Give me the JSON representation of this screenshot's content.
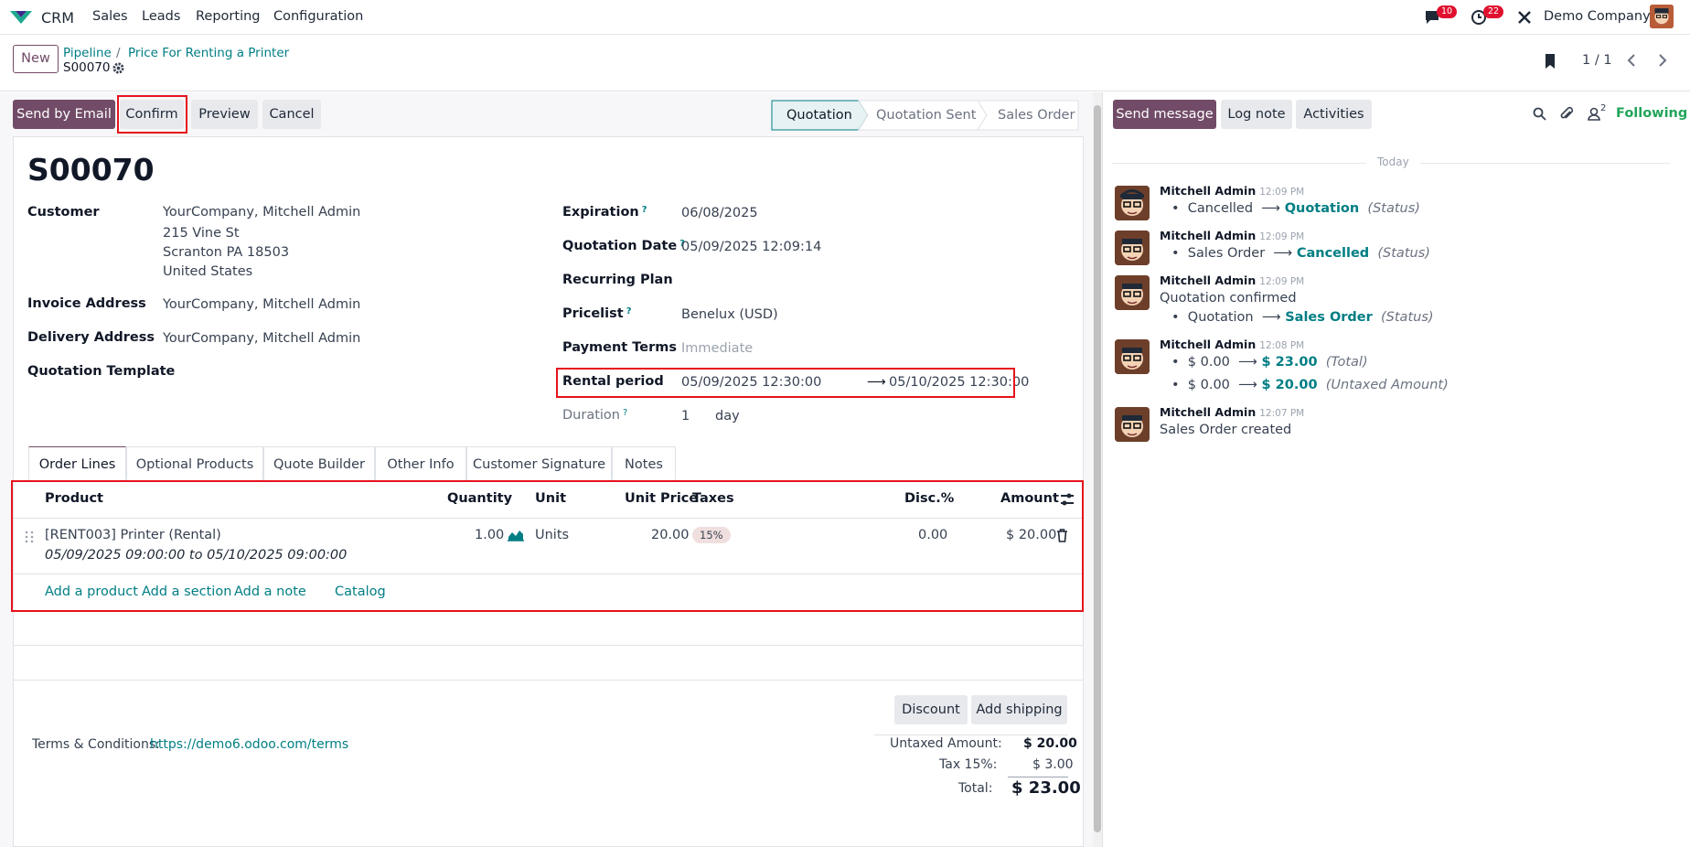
{
  "navbar": {
    "app_name": "CRM",
    "menus": [
      "Sales",
      "Leads",
      "Reporting",
      "Configuration"
    ],
    "messages_count": "10",
    "activities_count": "22",
    "company": "Demo Company"
  },
  "control_panel": {
    "new_label": "New",
    "breadcrumb_1": "Pipeline",
    "breadcrumb_2": "Price For Renting a Printer",
    "record_name": "S00070",
    "pager": "1 / 1"
  },
  "status_bar": {
    "buttons": [
      "Send by Email",
      "Confirm",
      "Preview",
      "Cancel"
    ],
    "stages": [
      "Quotation",
      "Quotation Sent",
      "Sales Order"
    ],
    "active_stage": "Quotation"
  },
  "form": {
    "title": "S00070",
    "customer_label": "Customer",
    "customer_lines": [
      "YourCompany, Mitchell Admin",
      "215 Vine St",
      "Scranton PA 18503",
      "United States"
    ],
    "invoice_label": "Invoice Address",
    "invoice_value": "YourCompany, Mitchell Admin",
    "delivery_label": "Delivery Address",
    "delivery_value": "YourCompany, Mitchell Admin",
    "template_label": "Quotation Template",
    "expiration_label": "Expiration",
    "expiration_value": "06/08/2025",
    "quotation_date_label": "Quotation Date",
    "quotation_date_value": "05/09/2025 12:09:14",
    "recurring_label": "Recurring Plan",
    "pricelist_label": "Pricelist",
    "pricelist_value": "Benelux (USD)",
    "payment_terms_label": "Payment Terms",
    "payment_terms_value": "Immediate",
    "rental_label": "Rental period",
    "rental_start": "05/09/2025 12:30:00",
    "rental_arrow": "⟶",
    "rental_end": "05/10/2025 12:30:00",
    "duration_label": "Duration",
    "duration_value": "1",
    "duration_unit": "day",
    "help_mark": "?"
  },
  "tabs": [
    "Order Lines",
    "Optional Products",
    "Quote Builder",
    "Other Info",
    "Customer Signature",
    "Notes"
  ],
  "order_table": {
    "headers": [
      "Product",
      "Quantity",
      "Unit",
      "Unit Price",
      "Taxes",
      "Disc.%",
      "Amount"
    ],
    "rows": [
      {
        "product": "[RENT003] Printer (Rental)",
        "description": "05/09/2025 09:00:00 to 05/10/2025 09:00:00",
        "quantity": "1.00",
        "unit": "Units",
        "unit_price": "20.00",
        "tax": "15%",
        "discount": "0.00",
        "amount": "$ 20.00"
      }
    ],
    "actions": [
      "Add a product",
      "Add a section",
      "Add a note",
      "Catalog"
    ]
  },
  "footer": {
    "discount_btn": "Discount",
    "shipping_btn": "Add shipping",
    "terms_label": "Terms & Conditions:",
    "terms_link": "https://demo6.odoo.com/terms",
    "untaxed_label": "Untaxed Amount:",
    "untaxed_value": "$ 20.00",
    "tax_label": "Tax 15%:",
    "tax_value": "$ 3.00",
    "total_label": "Total:",
    "total_value": "$ 23.00"
  },
  "chatter": {
    "send_message": "Send message",
    "log_note": "Log note",
    "activities": "Activities",
    "followers_count": "2",
    "following": "Following",
    "date_separator": "Today",
    "messages": [
      {
        "author": "Mitchell Admin",
        "time": "12:09 PM",
        "from": "Cancelled",
        "to": "Quotation",
        "field": "(Status)"
      },
      {
        "author": "Mitchell Admin",
        "time": "12:09 PM",
        "from": "Sales Order",
        "to": "Cancelled",
        "field": "(Status)"
      },
      {
        "author": "Mitchell Admin",
        "time": "12:09 PM",
        "body": "Quotation confirmed",
        "from": "Quotation",
        "to": "Sales Order",
        "field": "(Status)"
      },
      {
        "author": "Mitchell Admin",
        "time": "12:08 PM",
        "from": "$ 0.00",
        "to": "$ 23.00",
        "field": "(Total)",
        "from2": "$ 0.00",
        "to2": "$ 20.00",
        "field2": "(Untaxed Amount)"
      },
      {
        "author": "Mitchell Admin",
        "time": "12:07 PM",
        "body": "Sales Order created"
      }
    ],
    "arrow": "⟶",
    "bullet": "•"
  },
  "colors": {
    "primary": "#714b67",
    "link": "#017e84",
    "highlight": "#e6131c"
  }
}
